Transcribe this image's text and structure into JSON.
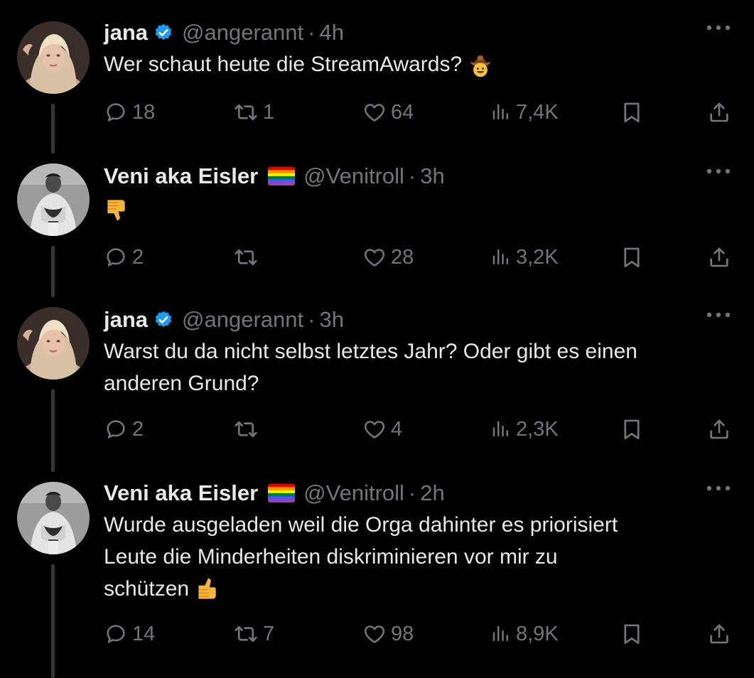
{
  "tweets": [
    {
      "name": "jana",
      "handle": "@angerannt",
      "separator": "·",
      "time": "4h",
      "text": "Wer schaut heute die StreamAwards?",
      "emoji": "cowboy-face",
      "verified": true,
      "flag": false,
      "replies": "18",
      "reposts": "1",
      "likes": "64",
      "views": "7,4K"
    },
    {
      "name": "Veni aka Eisler",
      "handle": "@Venitroll",
      "separator": "·",
      "time": "3h",
      "text": "",
      "emoji": "thumbs-down",
      "verified": false,
      "flag": true,
      "replies": "2",
      "reposts": "",
      "likes": "28",
      "views": "3,2K"
    },
    {
      "name": "jana",
      "handle": "@angerannt",
      "separator": "·",
      "time": "3h",
      "text_line1": "Warst du da nicht selbst letztes Jahr? Oder gibt es einen",
      "text_line2": "anderen Grund?",
      "verified": true,
      "flag": false,
      "replies": "2",
      "reposts": "",
      "likes": "4",
      "views": "2,3K"
    },
    {
      "name": "Veni aka Eisler",
      "handle": "@Venitroll",
      "separator": "·",
      "time": "2h",
      "text_line1": "Wurde ausgeladen weil die Orga dahinter es priorisiert",
      "text_line2": "Leute die Minderheiten diskriminieren vor mir zu",
      "text_line3": "schützen",
      "emoji": "thumbs-up",
      "verified": false,
      "flag": true,
      "replies": "14",
      "reposts": "7",
      "likes": "98",
      "views": "8,9K"
    }
  ],
  "colors": {
    "background": "#000000",
    "primary_text": "#e7e9ea",
    "secondary_text": "#71767b",
    "verified_blue": "#1d9bf0",
    "thread_line": "#333639"
  },
  "icons": [
    "reply-icon",
    "repost-icon",
    "like-icon",
    "views-icon",
    "bookmark-icon",
    "share-icon",
    "more-icon",
    "verified-badge-icon",
    "rainbow-flag-icon"
  ]
}
